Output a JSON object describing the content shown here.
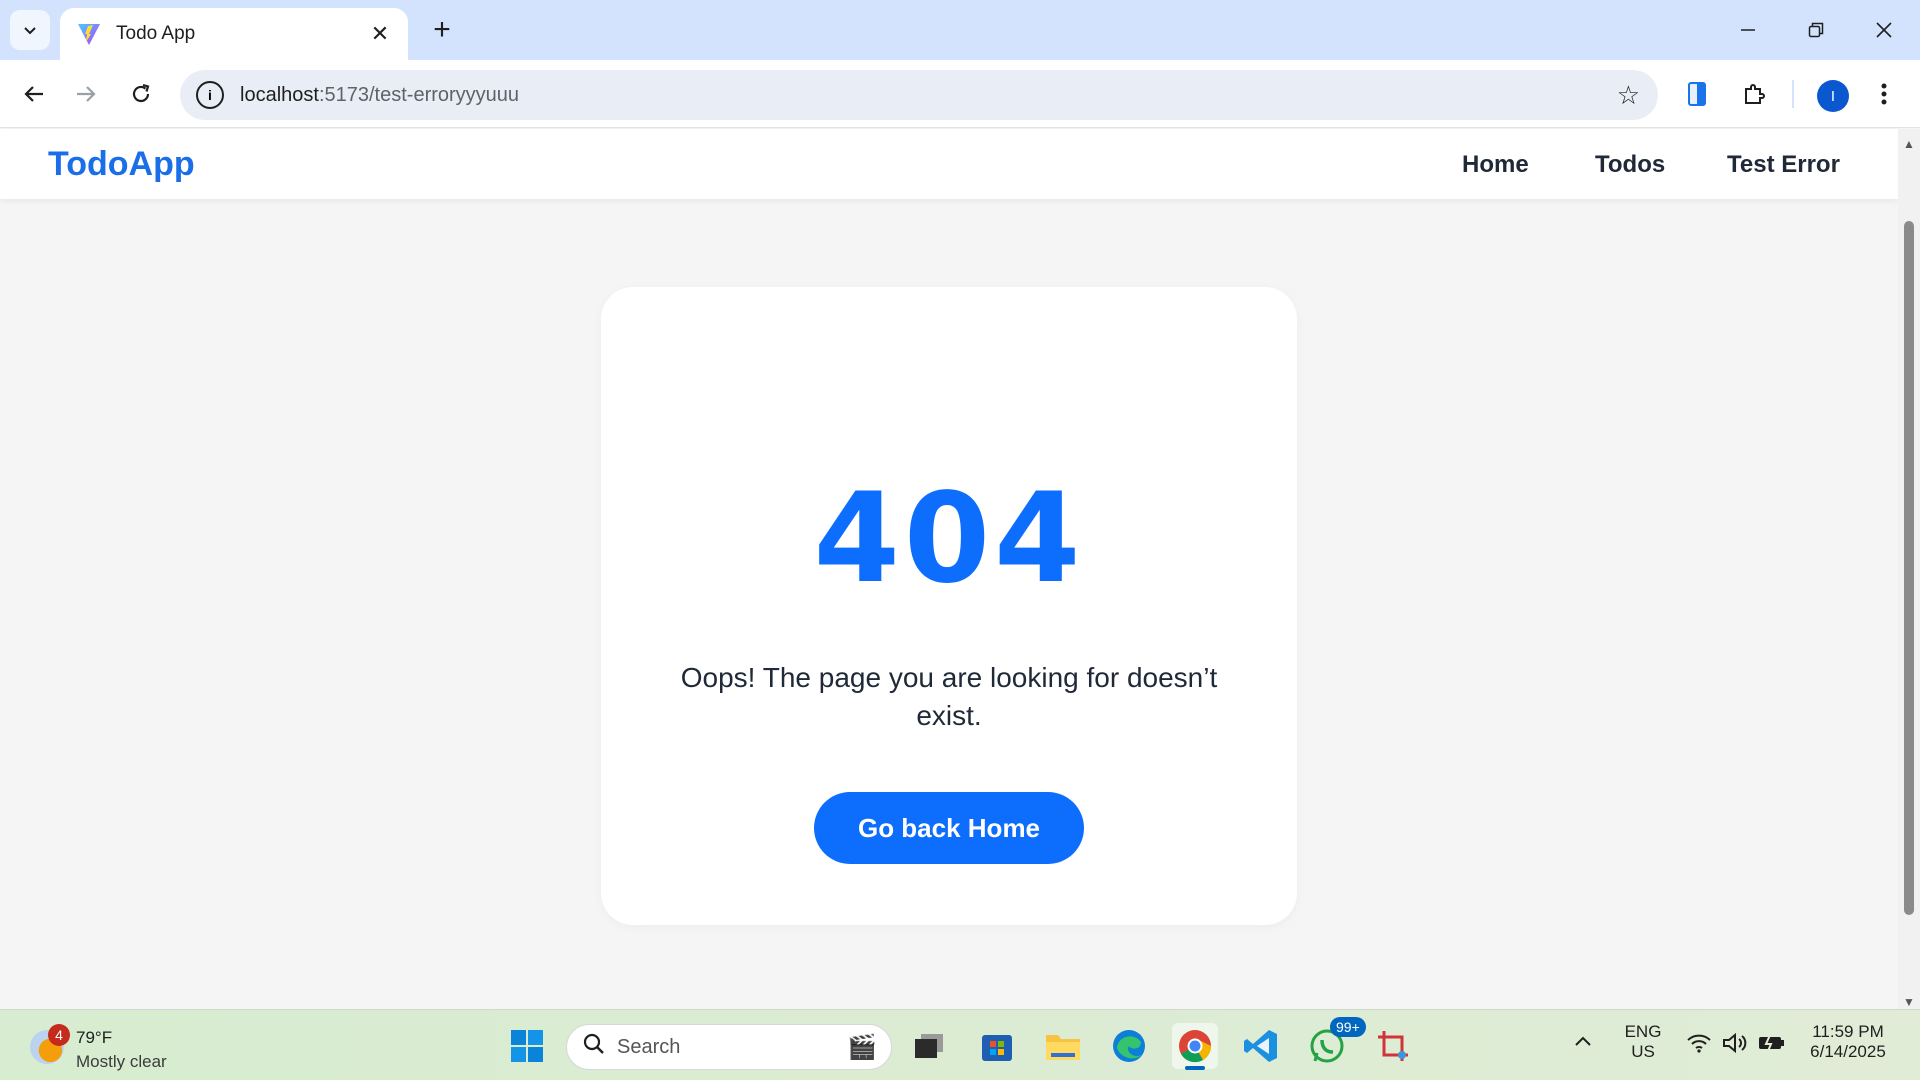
{
  "browser": {
    "tab_title": "Todo App",
    "tab_close": "✕",
    "new_tab": "+",
    "url_host": "localhost",
    "url_path": ":5173/test-erroryyyuuu",
    "profile_initial": "I"
  },
  "app": {
    "brand": "TodoApp",
    "nav": {
      "home": "Home",
      "todos": "Todos",
      "test_error": "Test Error"
    }
  },
  "error_card": {
    "code": "404",
    "message": "Oops! The page you are looking for doesn’t exist.",
    "button": "Go back Home"
  },
  "taskbar": {
    "weather_temp": "79°F",
    "weather_condition": "Mostly clear",
    "weather_badge": "4",
    "search_placeholder": "Search",
    "whatsapp_badge": "99+",
    "language": "ENG",
    "region": "US",
    "time": "11:59 PM",
    "date": "6/14/2025"
  },
  "colors": {
    "accent": "#0d6efd",
    "brand": "#1a6fe8",
    "tabbar": "#d3e3fd"
  }
}
